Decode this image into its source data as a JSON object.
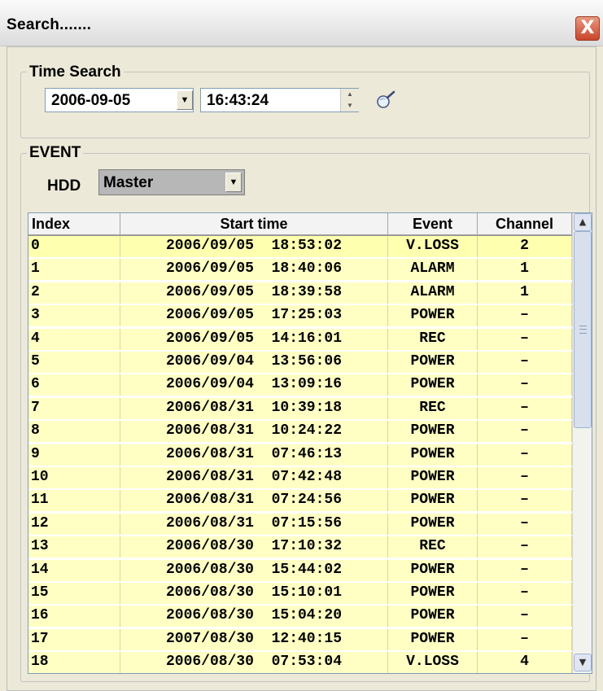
{
  "window": {
    "title": "Search.......",
    "close_label": "X"
  },
  "time_search": {
    "label": "Time Search",
    "date_value": "2006-09-05",
    "time_value": "16:43:24",
    "search_icon": "magnifier-search-icon"
  },
  "event": {
    "label": "EVENT",
    "hdd_label": "HDD",
    "hdd_value": "Master"
  },
  "table": {
    "columns": [
      "Index",
      "Start time",
      "Event",
      "Channel"
    ],
    "rows": [
      {
        "index": "0",
        "start": "2006/09/05  18:53:02",
        "event": "V.LOSS",
        "channel": "2"
      },
      {
        "index": "1",
        "start": "2006/09/05  18:40:06",
        "event": "ALARM",
        "channel": "1"
      },
      {
        "index": "2",
        "start": "2006/09/05  18:39:58",
        "event": "ALARM",
        "channel": "1"
      },
      {
        "index": "3",
        "start": "2006/09/05  17:25:03",
        "event": "POWER",
        "channel": "–"
      },
      {
        "index": "4",
        "start": "2006/09/05  14:16:01",
        "event": "REC",
        "channel": "–"
      },
      {
        "index": "5",
        "start": "2006/09/04  13:56:06",
        "event": "POWER",
        "channel": "–"
      },
      {
        "index": "6",
        "start": "2006/09/04  13:09:16",
        "event": "POWER",
        "channel": "–"
      },
      {
        "index": "7",
        "start": "2006/08/31  10:39:18",
        "event": "REC",
        "channel": "–"
      },
      {
        "index": "8",
        "start": "2006/08/31  10:24:22",
        "event": "POWER",
        "channel": "–"
      },
      {
        "index": "9",
        "start": "2006/08/31  07:46:13",
        "event": "POWER",
        "channel": "–"
      },
      {
        "index": "10",
        "start": "2006/08/31  07:42:48",
        "event": "POWER",
        "channel": "–"
      },
      {
        "index": "11",
        "start": "2006/08/31  07:24:56",
        "event": "POWER",
        "channel": "–"
      },
      {
        "index": "12",
        "start": "2006/08/31  07:15:56",
        "event": "POWER",
        "channel": "–"
      },
      {
        "index": "13",
        "start": "2006/08/30  17:10:32",
        "event": "REC",
        "channel": "–"
      },
      {
        "index": "14",
        "start": "2006/08/30  15:44:02",
        "event": "POWER",
        "channel": "–"
      },
      {
        "index": "15",
        "start": "2006/08/30  15:10:01",
        "event": "POWER",
        "channel": "–"
      },
      {
        "index": "16",
        "start": "2006/08/30  15:04:20",
        "event": "POWER",
        "channel": "–"
      },
      {
        "index": "17",
        "start": "2007/08/30  12:40:15",
        "event": "POWER",
        "channel": "–"
      },
      {
        "index": "18",
        "start": "2006/08/30  07:53:04",
        "event": "V.LOSS",
        "channel": "4"
      }
    ]
  },
  "colors": {
    "row_background": "#ffffc4",
    "window_background": "#ece9d8",
    "close_button": "#c9452a"
  }
}
